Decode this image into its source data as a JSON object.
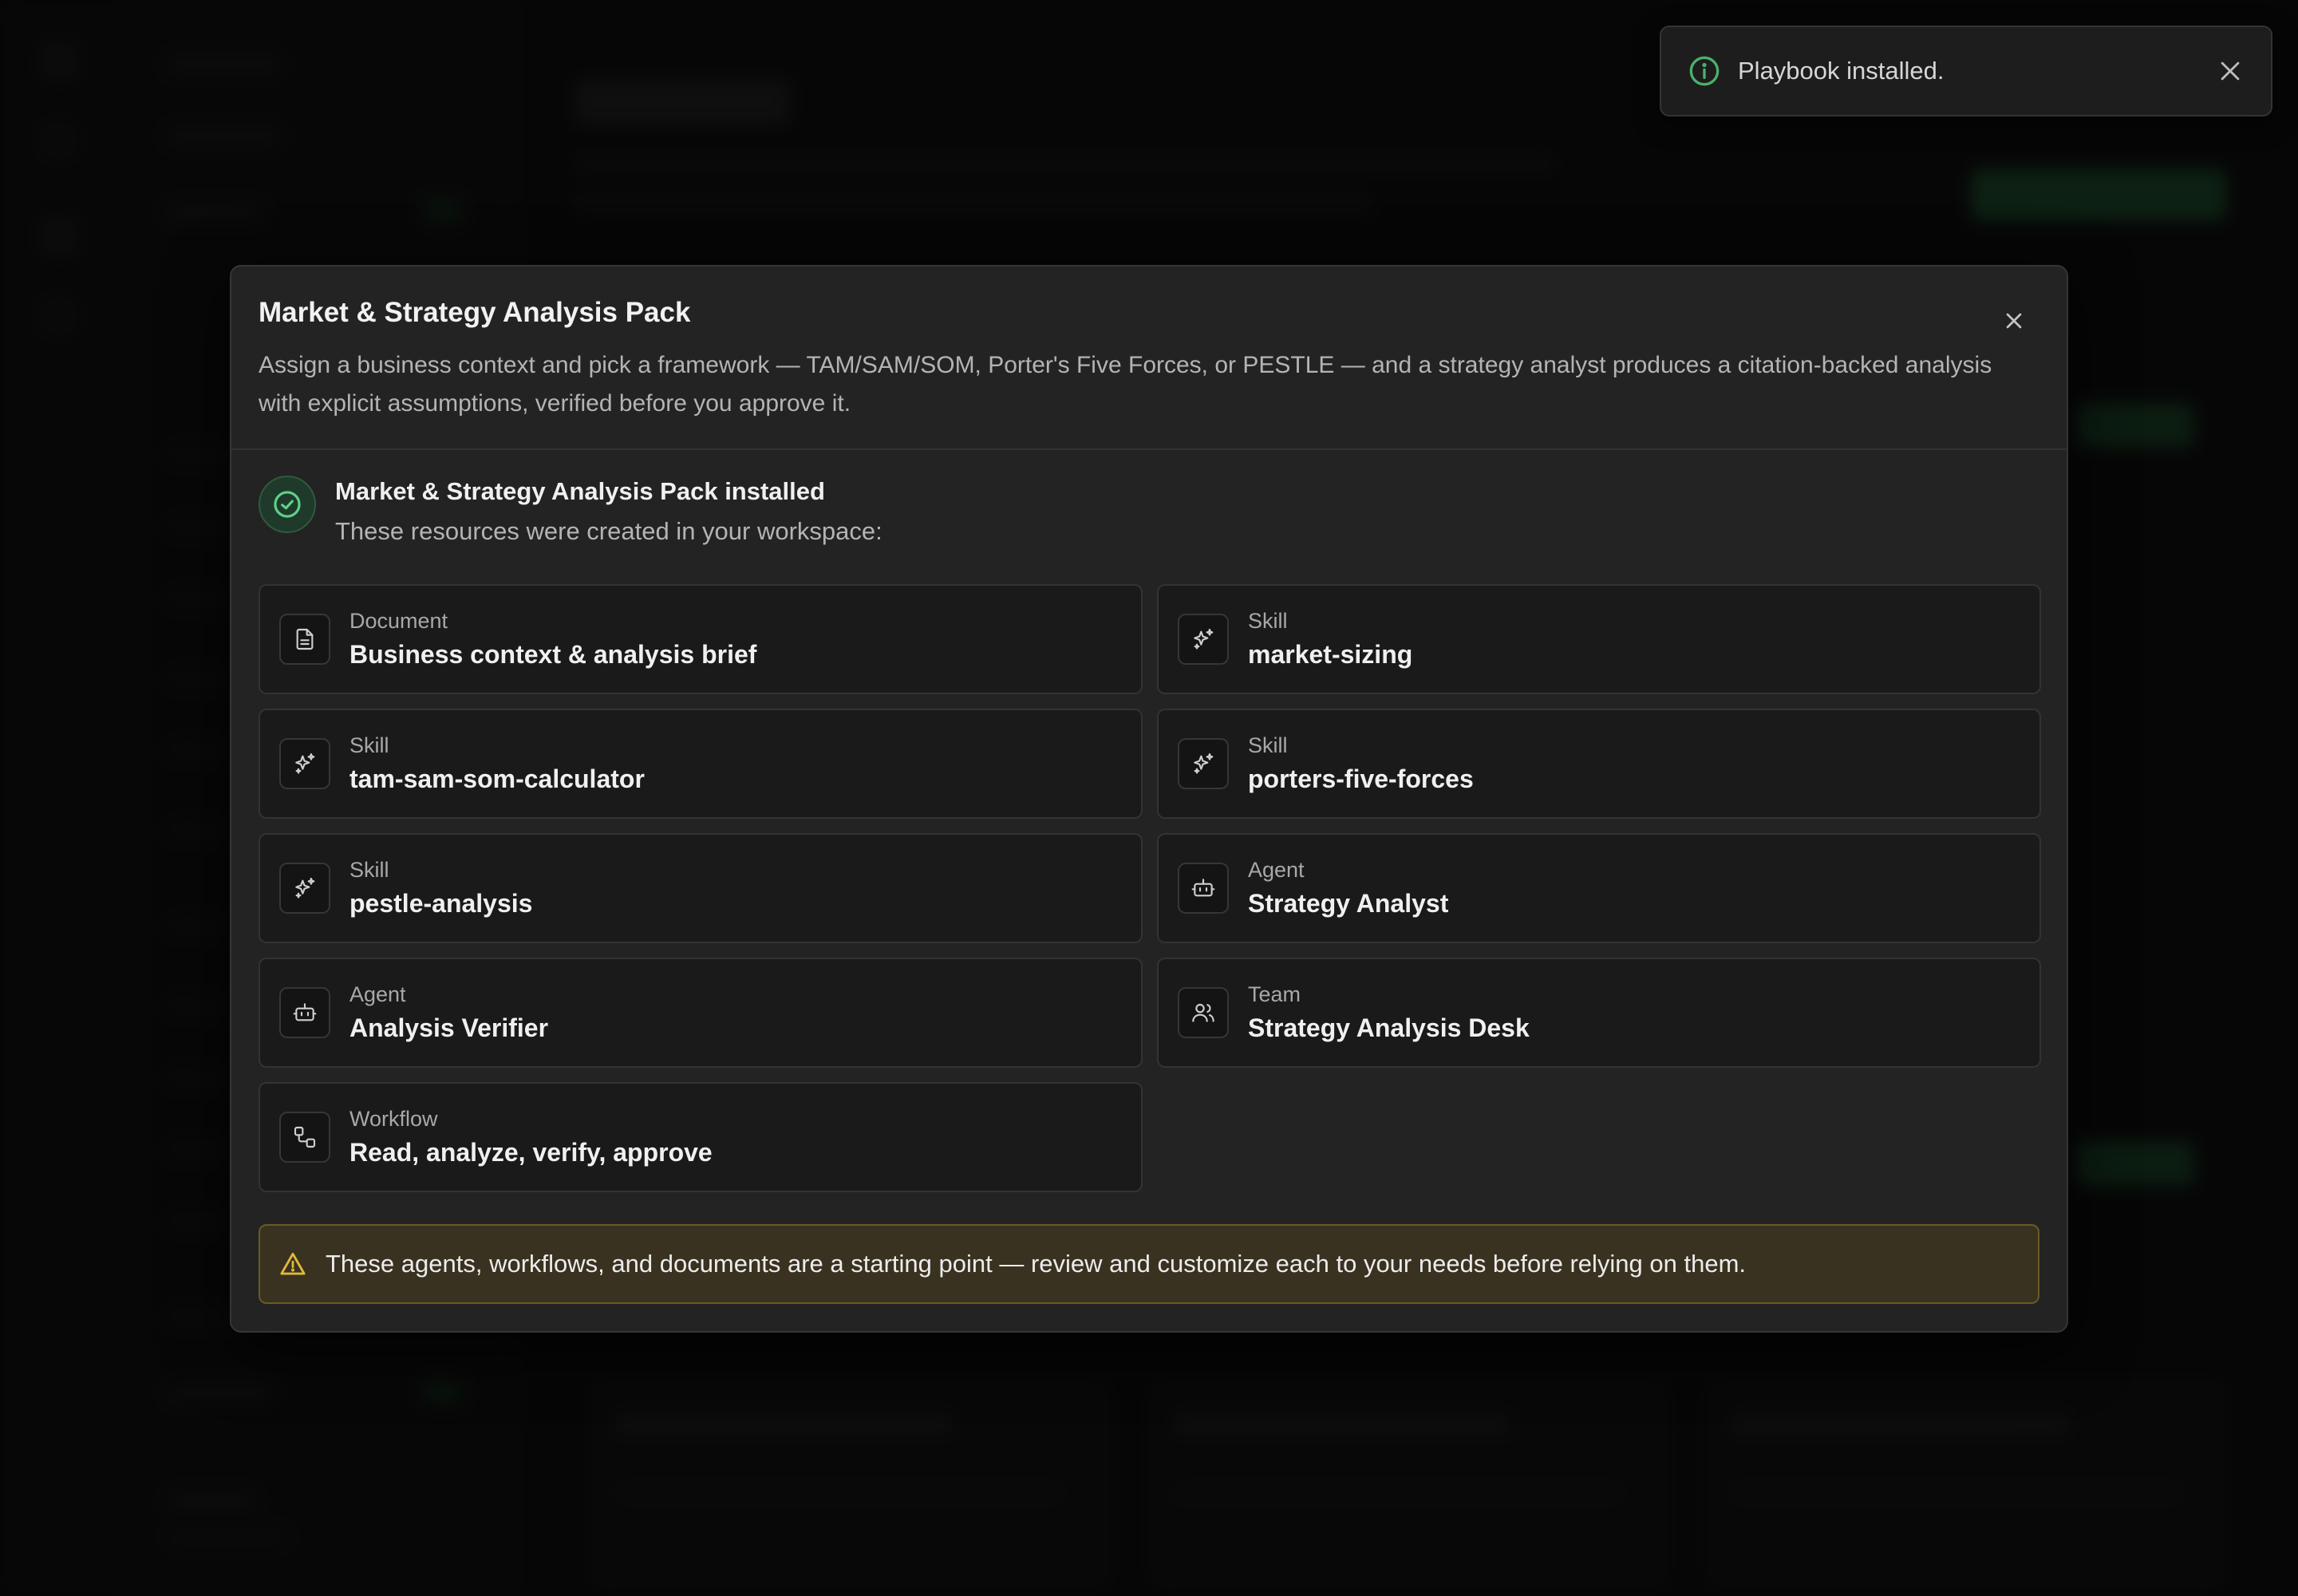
{
  "toast": {
    "message": "Playbook installed.",
    "icon": "info-icon",
    "accent": "#4caf6e"
  },
  "modal": {
    "title": "Market & Strategy Analysis Pack",
    "description": "Assign a business context and pick a framework — TAM/SAM/SOM, Porter's Five Forces, or PESTLE — and a strategy analyst produces a citation-backed analysis with explicit assumptions, verified before you approve it.",
    "installed": {
      "title": "Market & Strategy Analysis Pack installed",
      "subtitle": "These resources were created in your workspace:"
    },
    "resources": [
      {
        "type": "Document",
        "name": "Business context & analysis brief",
        "icon": "document-icon"
      },
      {
        "type": "Skill",
        "name": "market-sizing",
        "icon": "sparkle-icon"
      },
      {
        "type": "Skill",
        "name": "tam-sam-som-calculator",
        "icon": "sparkle-icon"
      },
      {
        "type": "Skill",
        "name": "porters-five-forces",
        "icon": "sparkle-icon"
      },
      {
        "type": "Skill",
        "name": "pestle-analysis",
        "icon": "sparkle-icon"
      },
      {
        "type": "Agent",
        "name": "Strategy Analyst",
        "icon": "bot-icon"
      },
      {
        "type": "Agent",
        "name": "Analysis Verifier",
        "icon": "bot-icon"
      },
      {
        "type": "Team",
        "name": "Strategy Analysis Desk",
        "icon": "users-icon"
      },
      {
        "type": "Workflow",
        "name": "Read, analyze, verify, approve",
        "icon": "workflow-icon"
      }
    ],
    "warning": "These agents, workflows, and documents are a starting point — review and customize each to your needs before relying on them."
  },
  "colors": {
    "success": "#4caf6e",
    "warning_border": "#6a5a22",
    "warning_bg": "#3a3220",
    "warning_icon": "#e0b83a"
  }
}
